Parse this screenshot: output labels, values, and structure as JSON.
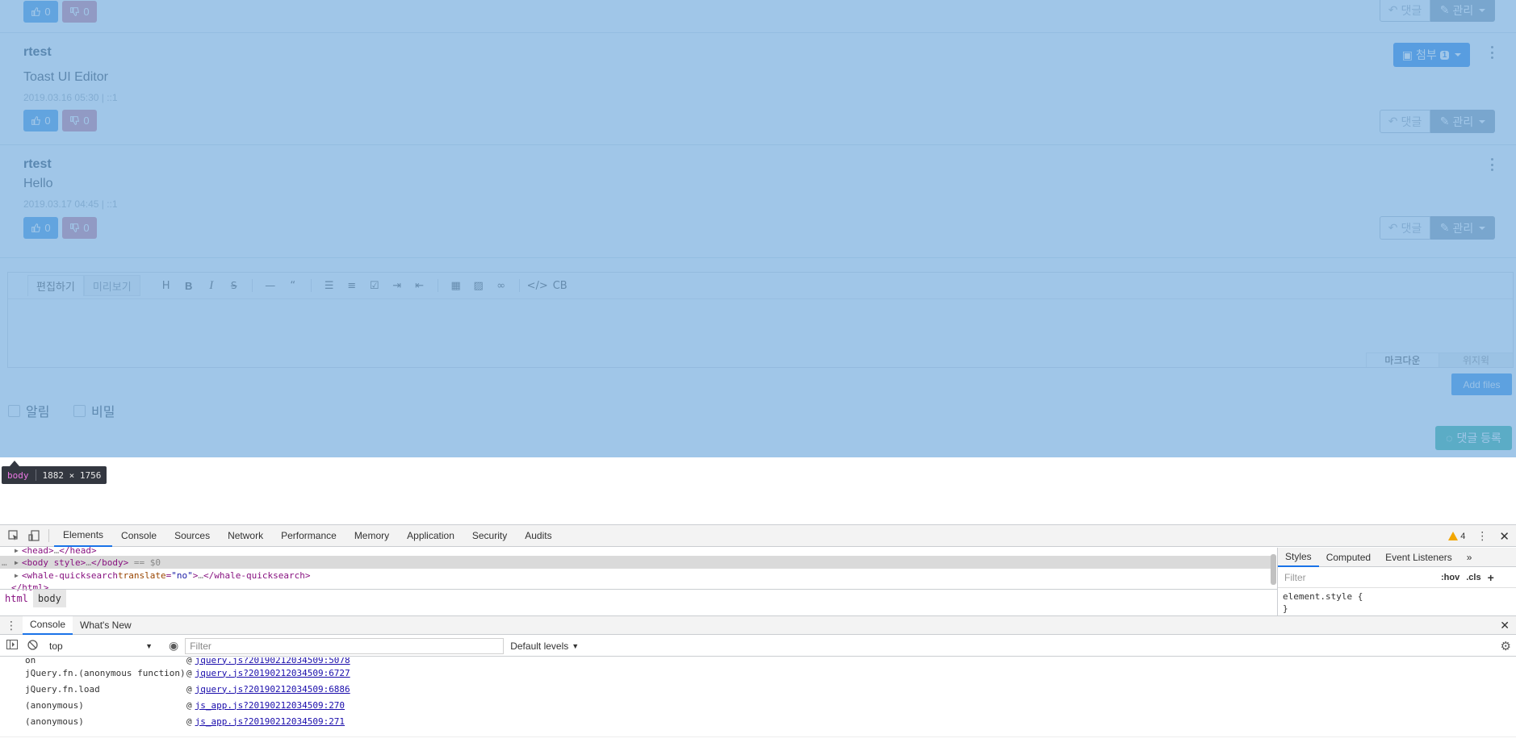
{
  "comments": [
    {
      "author": "",
      "text": "",
      "meta": "",
      "likes": "0",
      "dislikes": "0",
      "reply_label": "댓글",
      "manage_label": "관리"
    },
    {
      "author": "rtest",
      "text": "Toast UI Editor",
      "meta": "2019.03.16 05:30 | ::1",
      "likes": "0",
      "dislikes": "0",
      "reply_label": "댓글",
      "manage_label": "관리",
      "attach_label": "첨부",
      "attach_count": "1"
    },
    {
      "author": "rtest",
      "text": "Hello",
      "meta": "2019.03.17 04:45 | ::1",
      "likes": "0",
      "dislikes": "0",
      "reply_label": "댓글",
      "manage_label": "관리"
    }
  ],
  "editor": {
    "tab_edit": "편집하기",
    "tab_preview": "미리보기",
    "toolbar": [
      "H",
      "B",
      "I",
      "S",
      "—",
      "“",
      "list",
      "olist",
      "task",
      "indent",
      "outdent",
      "table",
      "image",
      "link",
      "</>",
      "CB"
    ],
    "mode_markdown": "마크다운",
    "mode_wysiwyg": "위지윅"
  },
  "add_files_label": "Add files",
  "checkbox_notify": "알림",
  "checkbox_secret": "비밀",
  "submit_label": "댓글 등록",
  "tooltip": {
    "tag": "body",
    "size": "1882 × 1756"
  },
  "devtools": {
    "tabs": [
      "Elements",
      "Console",
      "Sources",
      "Network",
      "Performance",
      "Memory",
      "Application",
      "Security",
      "Audits"
    ],
    "active_tab": "Elements",
    "warning_count": "4",
    "dom_lines": [
      {
        "open": "<head>",
        "ellipsis": "…",
        "close": "</head>"
      },
      {
        "open": "<body style>",
        "ellipsis": "…",
        "close": "</body>",
        "suffix": " == $0"
      },
      {
        "tag": "whale-quicksearch",
        "attr": "translate",
        "val": "\"no\"",
        "ellipsis": "…",
        "close": "</whale-quicksearch>"
      },
      {
        "close_only": "</html>"
      }
    ],
    "breadcrumbs": [
      "html",
      "body"
    ],
    "styles_tabs": [
      "Styles",
      "Computed",
      "Event Listeners",
      "»"
    ],
    "styles_filter_placeholder": "Filter",
    "styles_hov": ":hov",
    "styles_cls": ".cls",
    "styles_plus": "+",
    "element_style": "element.style {",
    "element_style_close": "}",
    "drawer_tabs": [
      "Console",
      "What's New"
    ],
    "context": "top",
    "console_filter_placeholder": "Filter",
    "levels": "Default levels",
    "trace": [
      {
        "fn": "on",
        "link": "jquery.js?20190212034509:5078"
      },
      {
        "fn": "jQuery.fn.(anonymous function)",
        "link": "jquery.js?20190212034509:6727"
      },
      {
        "fn": "jQuery.fn.load",
        "link": "jquery.js?20190212034509:6886"
      },
      {
        "fn": "(anonymous)",
        "link": "js_app.js?20190212034509:270"
      },
      {
        "fn": "(anonymous)",
        "link": "js_app.js?20190212034509:271"
      }
    ],
    "at_symbol": "@",
    "prompt": ">"
  }
}
